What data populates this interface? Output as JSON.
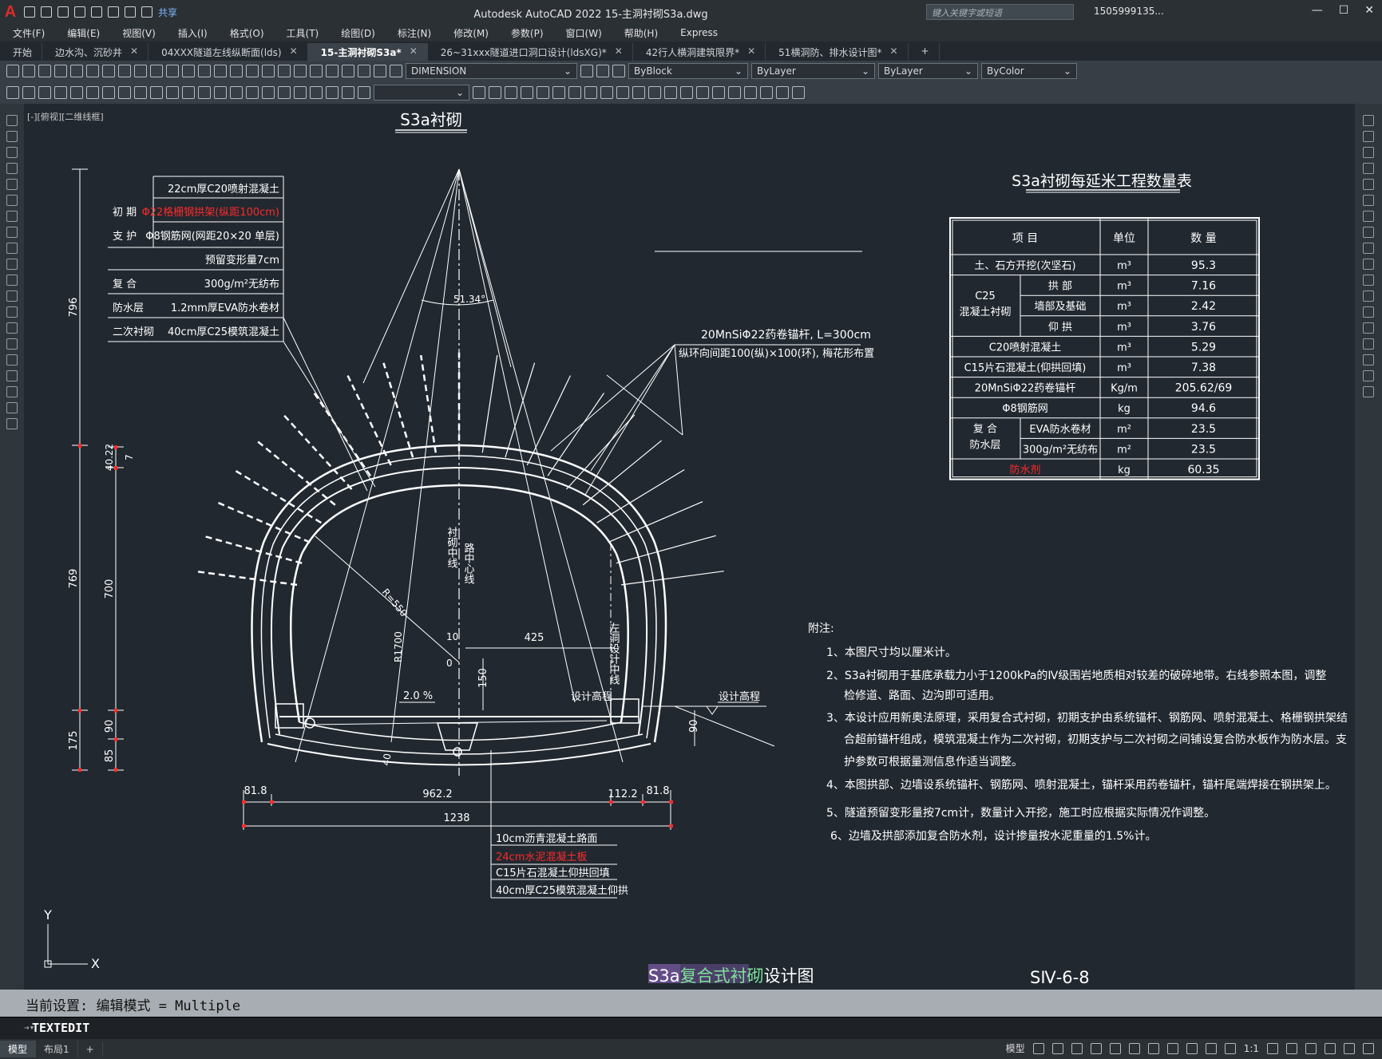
{
  "app": {
    "logo": "A",
    "title": "Autodesk AutoCAD 2022    15-主洞衬砌S3a.dwg",
    "share": "共享",
    "search_placeholder": "键入关键字或短语",
    "user": "1505999135...",
    "win_min": "—",
    "win_max": "☐",
    "win_close": "✕"
  },
  "menu": [
    "文件(F)",
    "编辑(E)",
    "视图(V)",
    "插入(I)",
    "格式(O)",
    "工具(T)",
    "绘图(D)",
    "标注(N)",
    "修改(M)",
    "参数(P)",
    "窗口(W)",
    "帮助(H)",
    "Express"
  ],
  "tabs": [
    {
      "label": "开始"
    },
    {
      "label": "边水沟、沉砂井"
    },
    {
      "label": "04XXX隧道左线纵断面(lds)"
    },
    {
      "label": "15-主洞衬砌S3a*",
      "active": true
    },
    {
      "label": "26~31xxx隧道进口洞口设计(ldsXG)*"
    },
    {
      "label": "42行人横洞建筑限界*"
    },
    {
      "label": "51横洞防、排水设计图*"
    }
  ],
  "toolbar": {
    "layer": "DIMENSION",
    "color": "ByBlock",
    "linetype": "ByLayer",
    "lineweight": "ByLayer",
    "plotstyle": "ByColor"
  },
  "view_label": "[-][俯视][二维线框]",
  "drawing": {
    "section_title": "S3a衬砌",
    "callouts": [
      {
        "group": "",
        "text": "22cm厚C20喷射混凝土"
      },
      {
        "group": "初  期",
        "text": "Φ22格栅钢拱架(纵距100cm)",
        "red": true
      },
      {
        "group": "支  护",
        "text": "Φ8钢筋网(网距20×20 单层)"
      },
      {
        "group": "",
        "text": "预留变形量7cm"
      },
      {
        "group": "复  合",
        "text": "300g/m²无纺布"
      },
      {
        "group": "防水层",
        "text": "1.2mm厚EVA防水卷材"
      },
      {
        "group": "二次衬砌",
        "text": "40cm厚C25模筑混凝土"
      }
    ],
    "bolt_note1": "20MnSiΦ22药卷锚杆, L=300cm",
    "bolt_note2": "纵环向间距100(纵)×100(环), 梅花形布置",
    "angle": "51.34°",
    "radius_small": "R=550",
    "radius_large": "R1700",
    "slope": "2.0 %",
    "dims_left": [
      "796",
      "769",
      "175",
      "40.22",
      "7",
      "700",
      "90",
      "85"
    ],
    "dims_bottom": [
      "81.8",
      "962.2",
      "112.2",
      "81.8",
      "1238"
    ],
    "dim_425": "425",
    "dim_150": "150",
    "dim_90r": "90",
    "dim_10": "10",
    "dim_0": "0",
    "dim_40": "40",
    "center_label1": "衬砌中线",
    "center_label2": "路中心线",
    "left_label": "左洞设计中线",
    "design_elev": "设计高程",
    "pavement": [
      {
        "text": "10cm沥青混凝土路面"
      },
      {
        "text": "24cm水泥混凝土板",
        "red": true
      },
      {
        "text": "C15片石混凝土仰拱回填"
      },
      {
        "text": "40cm厚C25模筑混凝土仰拱"
      }
    ],
    "table_title": "S3a衬砌每延米工程数量表",
    "table_headers": [
      "项    目",
      "单位",
      "数    量"
    ],
    "table_rows": [
      {
        "group": "",
        "item": "土、石方开挖(次坚石)",
        "unit": "m³",
        "qty": "95.3"
      },
      {
        "group": "C25\n混凝土衬砌",
        "item": "拱    部",
        "unit": "m³",
        "qty": "7.16"
      },
      {
        "group": "",
        "item": "墙部及基础",
        "unit": "m³",
        "qty": "2.42"
      },
      {
        "group": "",
        "item": "仰    拱",
        "unit": "m³",
        "qty": "3.76"
      },
      {
        "group": "",
        "item": "C20喷射混凝土",
        "unit": "m³",
        "qty": "5.29"
      },
      {
        "group": "",
        "item": "C15片石混凝土(仰拱回填)",
        "unit": "m³",
        "qty": "7.38"
      },
      {
        "group": "",
        "item": "20MnSiΦ22药卷锚杆",
        "unit": "Kg/m",
        "qty": "205.62/69"
      },
      {
        "group": "",
        "item": "Φ8钢筋网",
        "unit": "kg",
        "qty": "94.6"
      },
      {
        "group": "复 合\n防水层",
        "item": "EVA防水卷材",
        "unit": "m²",
        "qty": "23.5"
      },
      {
        "group": "",
        "item": "300g/m²无纺布",
        "unit": "m²",
        "qty": "23.5"
      },
      {
        "group": "",
        "item": "防水剂",
        "unit": "kg",
        "qty": "60.35",
        "red": true
      }
    ],
    "notes_title": "附注:",
    "notes": [
      "1、本图尺寸均以厘米计。",
      "2、S3a衬砌用于基底承载力小于1200kPa的Ⅳ级围岩地质相对较差的破碎地带。右线参照本图，调整",
      "检修道、路面、边沟即可适用。",
      "3、本设计应用新奥法原理，采用复合式衬砌，初期支护由系统锚杆、钢筋网、喷射混凝土、格栅钢拱架结",
      "合超前锚杆组成，模筑混凝土作为二次衬砌，初期支护与二次衬砌之间铺设复合防水板作为防水层。支",
      "护参数可根据量测信息作适当调整。",
      "4、本图拱部、边墙设系统锚杆、钢筋网、喷射混凝土，锚杆采用药卷锚杆，锚杆尾端焊接在钢拱架上。",
      "5、隧道预留变形量按7cm计，数量计入开挖，施工时应根据实际情况作调整。",
      "6、边墙及拱部添加复合防水剂，设计掺量按水泥重量的1.5%计。"
    ],
    "sheet_title_hl": "S3a",
    "sheet_title_mid": "复合式衬砌",
    "sheet_title_end": "设计图",
    "sheet_no": "SⅣ-6-8",
    "ucs_x": "X",
    "ucs_y": "Y"
  },
  "command": {
    "history": "当前设置: 编辑模式 = Multiple",
    "current": "TEXTEDIT",
    "prompt": "⇢▾"
  },
  "status": {
    "tabs": [
      "模型",
      "布局1"
    ],
    "add": "+",
    "model": "模型",
    "scale": "1:1"
  }
}
